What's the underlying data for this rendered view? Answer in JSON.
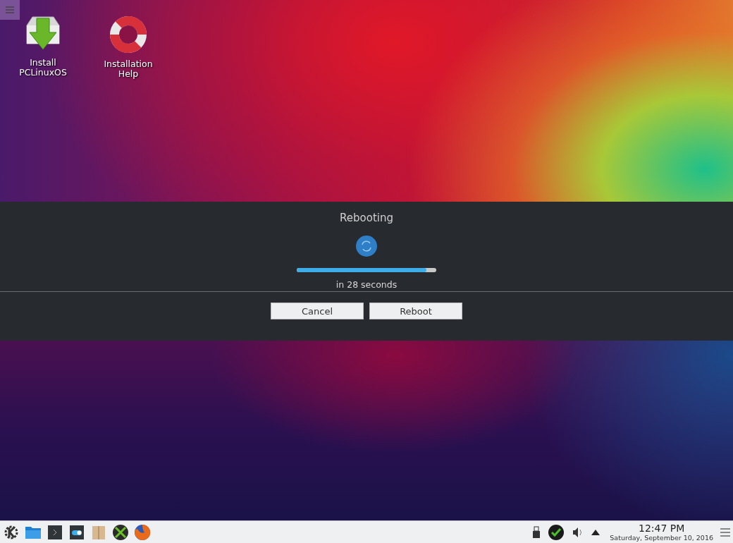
{
  "desktop_icons": [
    {
      "kind": "install",
      "label": "Install PCLinuxOS"
    },
    {
      "kind": "help",
      "label": "Installation Help"
    }
  ],
  "dialog": {
    "title": "Rebooting",
    "progress": {
      "level": 0.93
    },
    "countdown": "in 28 seconds",
    "buttons": [
      "Cancel",
      "Reboot"
    ]
  },
  "taskbar": {
    "clock": {
      "time": "12:47 PM",
      "date": "Saturday, September 10, 2016"
    }
  }
}
